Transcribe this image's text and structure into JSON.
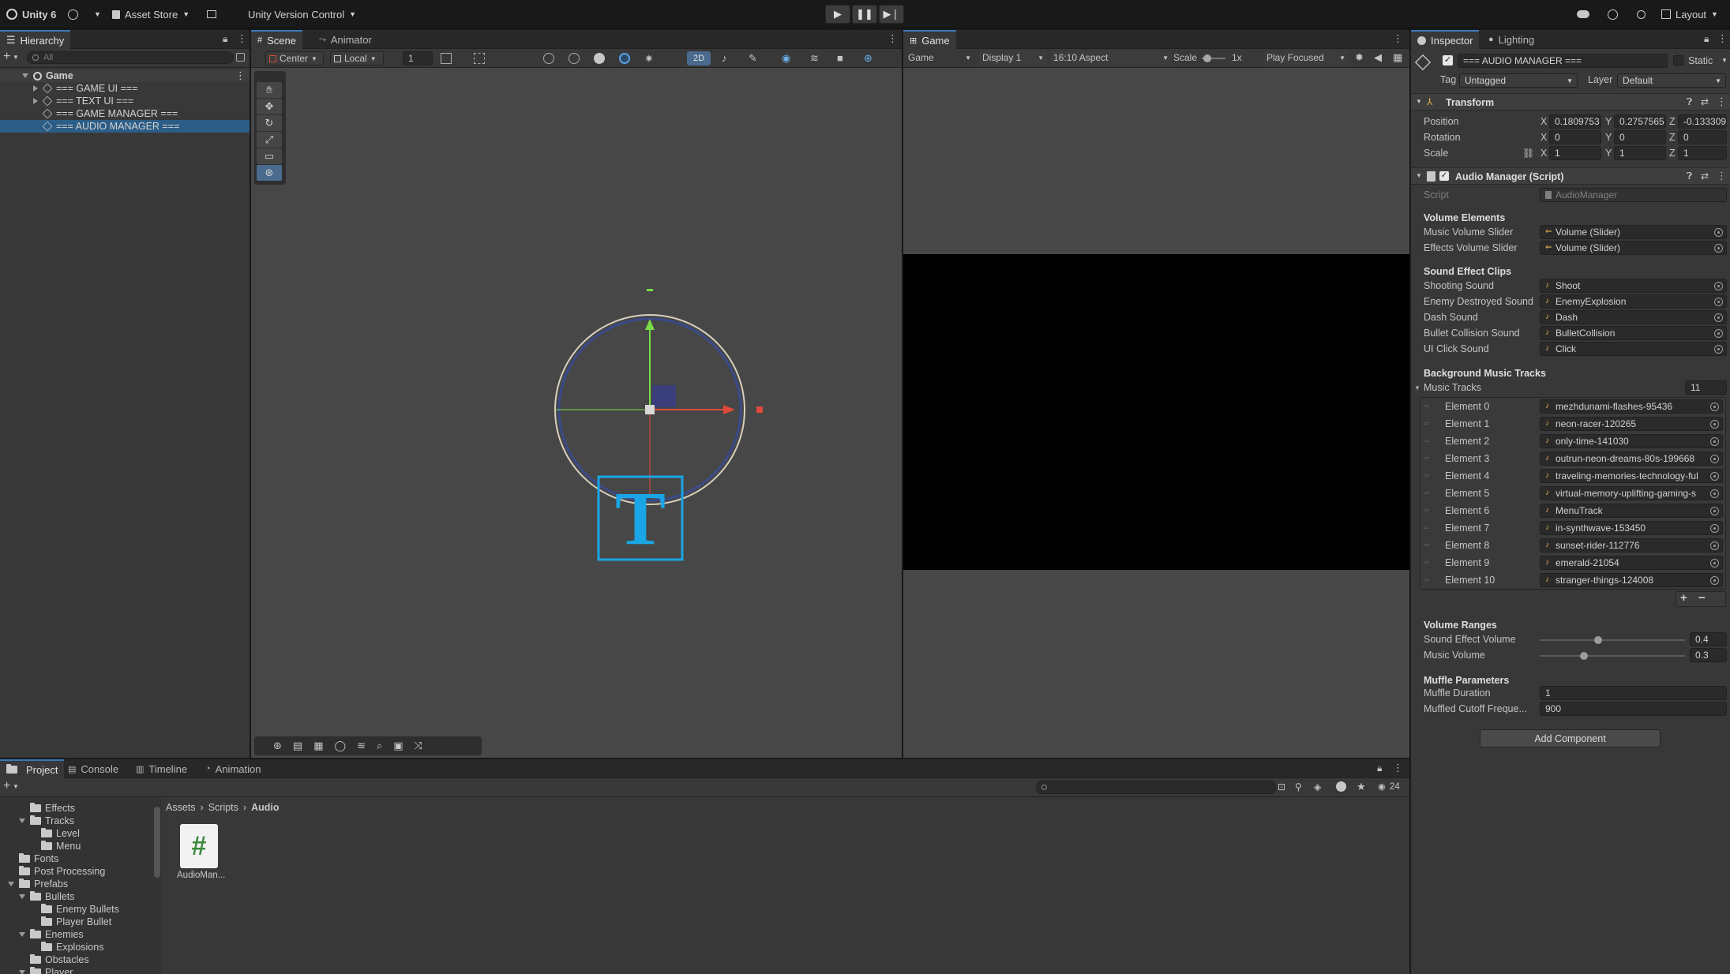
{
  "topbar": {
    "app_name": "Unity 6",
    "asset_store": "Asset Store",
    "version_control": "Unity Version Control",
    "layout": "Layout"
  },
  "hierarchy": {
    "tab": "Hierarchy",
    "search_placeholder": "All",
    "scene": "Game",
    "items": [
      "=== GAME UI ===",
      "=== TEXT UI ===",
      "=== GAME MANAGER ===",
      "=== AUDIO MANAGER ==="
    ]
  },
  "scene": {
    "tabs": [
      "Scene",
      "Animator"
    ],
    "pivot": "Center",
    "space": "Local",
    "grid_value": "1",
    "mode_2d": "2D",
    "text_gizmo": "T"
  },
  "game": {
    "tab": "Game",
    "view": "Game",
    "display": "Display 1",
    "aspect": "16:10 Aspect",
    "scale_label": "Scale",
    "scale_value": "1x",
    "play_mode": "Play Focused"
  },
  "inspector": {
    "tabs": [
      "Inspector",
      "Lighting"
    ],
    "object_name": "=== AUDIO MANAGER ===",
    "static_label": "Static",
    "tag_label": "Tag",
    "tag_value": "Untagged",
    "layer_label": "Layer",
    "layer_value": "Default",
    "transform": {
      "title": "Transform",
      "position_label": "Position",
      "position": {
        "x": "0.1809753",
        "y": "0.2757565",
        "z": "-0.133309"
      },
      "rotation_label": "Rotation",
      "rotation": {
        "x": "0",
        "y": "0",
        "z": "0"
      },
      "scale_label": "Scale",
      "scale": {
        "x": "1",
        "y": "1",
        "z": "1"
      }
    },
    "script_comp": {
      "title": "Audio Manager (Script)",
      "script_label": "Script",
      "script_value": "AudioManager"
    },
    "volume_elements": {
      "header": "Volume Elements",
      "fields": [
        {
          "label": "Music Volume Slider",
          "value": "Volume (Slider)"
        },
        {
          "label": "Effects Volume Slider",
          "value": "Volume (Slider)"
        }
      ]
    },
    "sound_clips": {
      "header": "Sound Effect Clips",
      "fields": [
        {
          "label": "Shooting Sound",
          "value": "Shoot"
        },
        {
          "label": "Enemy Destroyed Sound",
          "value": "EnemyExplosion"
        },
        {
          "label": "Dash Sound",
          "value": "Dash"
        },
        {
          "label": "Bullet Collision Sound",
          "value": "BulletCollision"
        },
        {
          "label": "UI Click Sound",
          "value": "Click"
        }
      ]
    },
    "music": {
      "header": "Background Music Tracks",
      "list_label": "Music Tracks",
      "count": "11",
      "elements": [
        {
          "label": "Element 0",
          "value": "mezhdunami-flashes-95436"
        },
        {
          "label": "Element 1",
          "value": "neon-racer-120265"
        },
        {
          "label": "Element 2",
          "value": "only-time-141030"
        },
        {
          "label": "Element 3",
          "value": "outrun-neon-dreams-80s-199668"
        },
        {
          "label": "Element 4",
          "value": "traveling-memories-technology-ful"
        },
        {
          "label": "Element 5",
          "value": "virtual-memory-uplifting-gaming-s"
        },
        {
          "label": "Element 6",
          "value": "MenuTrack"
        },
        {
          "label": "Element 7",
          "value": "in-synthwave-153450"
        },
        {
          "label": "Element 8",
          "value": "sunset-rider-112776"
        },
        {
          "label": "Element 9",
          "value": "emerald-21054"
        },
        {
          "label": "Element 10",
          "value": "stranger-things-124008"
        }
      ]
    },
    "ranges": {
      "header": "Volume Ranges",
      "sfx_label": "Sound Effect Volume",
      "sfx_value": "0.4",
      "music_label": "Music Volume",
      "music_value": "0.3"
    },
    "muffle": {
      "header": "Muffle Parameters",
      "duration_label": "Muffle Duration",
      "duration_value": "1",
      "cutoff_label": "Muffled Cutoff Freque...",
      "cutoff_value": "900"
    },
    "add_component": "Add Component"
  },
  "bottom": {
    "tabs": [
      "Project",
      "Console",
      "Timeline",
      "Animation"
    ],
    "visible_count": "24",
    "breadcrumb": [
      "Assets",
      "Scripts",
      "Audio"
    ],
    "asset_name": "AudioMan...",
    "tree": [
      "Effects",
      "Tracks",
      "Level",
      "Menu",
      "Fonts",
      "Post Processing",
      "Prefabs",
      "Bullets",
      "Enemy Bullets",
      "Player Bullet",
      "Enemies",
      "Explosions",
      "Obstacles",
      "Player"
    ]
  }
}
